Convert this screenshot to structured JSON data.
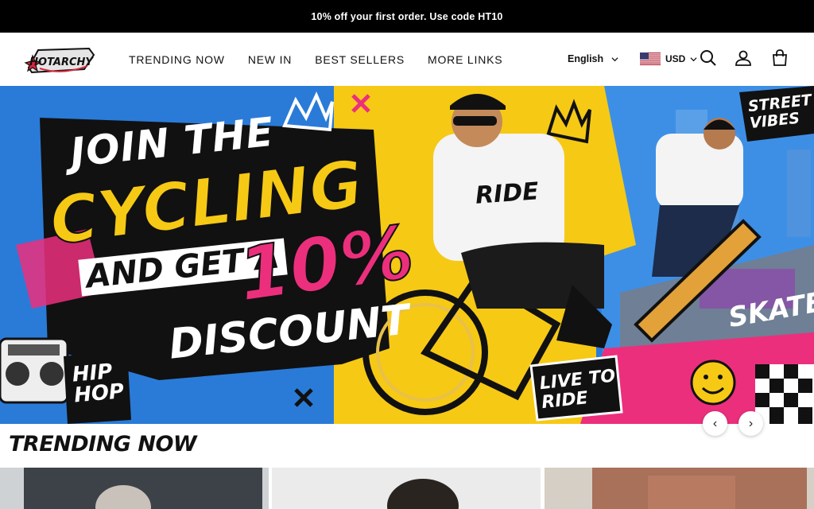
{
  "announcement": {
    "text": "10% off your first order. Use code HT10"
  },
  "header": {
    "logo_text": "HOTARCHY",
    "nav": [
      {
        "label": "TRENDING NOW"
      },
      {
        "label": "NEW IN"
      },
      {
        "label": "BEST SELLERS"
      },
      {
        "label": "MORE LINKS"
      }
    ],
    "language": "English",
    "currency": "USD",
    "icons": [
      "search-icon",
      "account-icon",
      "cart-icon"
    ]
  },
  "hero": {
    "headline_1": "JOIN THE",
    "headline_2": "CYCLING",
    "headline_3": "AND GET A",
    "headline_4": "10%",
    "headline_5": "DISCOUNT",
    "badge_top_right": "STREET VIBES",
    "badge_skate": "SKATE",
    "badge_hiphop": "HIP HOP",
    "badge_live": "LIVE TO RIDE",
    "shirt_text": "RIDE",
    "colors": {
      "yellow": "#f6c915",
      "pink": "#ec2f7c",
      "blue": "#2a7bd8",
      "black": "#111111"
    }
  },
  "carousel": {
    "prev": "‹",
    "next": "›"
  },
  "section": {
    "title": "TRENDING NOW"
  }
}
